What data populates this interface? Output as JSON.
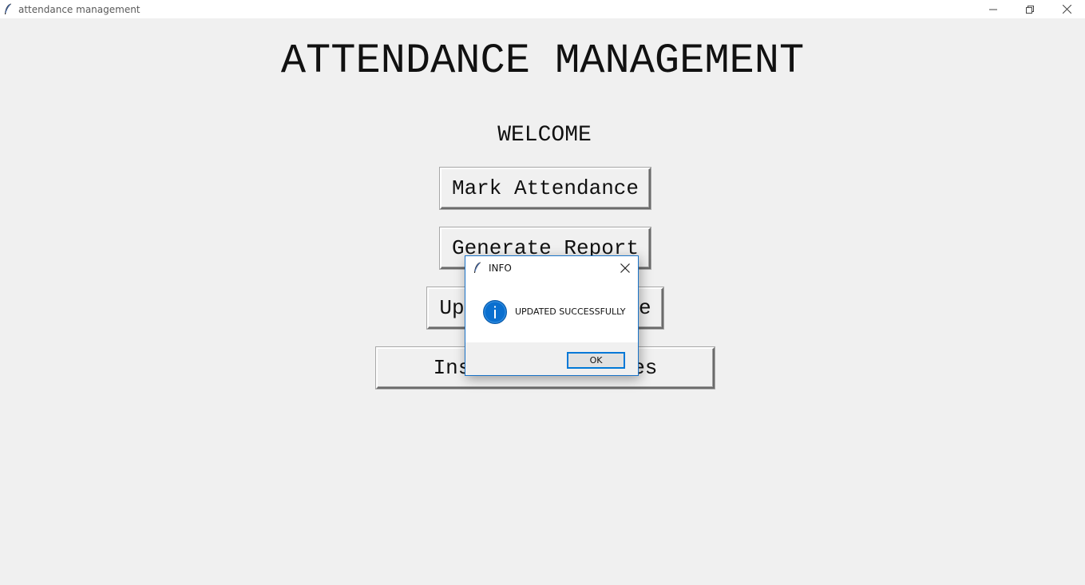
{
  "window": {
    "title": "attendance management"
  },
  "main": {
    "heading": "ATTENDANCE MANAGEMENT",
    "welcome": "WELCOME",
    "buttons": {
      "mark_attendance": "Mark Attendance",
      "generate_report": "Generate Report",
      "update_attendance": "Update Attendance",
      "insert_tables": "Insert Into Tables"
    }
  },
  "dialog": {
    "title": "INFO",
    "message": "UPDATED SUCCESSFULLY",
    "ok_label": "OK",
    "icon": "info-icon"
  },
  "colors": {
    "background": "#f0f0f0",
    "dialog_border": "#1a73c8",
    "info_icon": "#0a6fcf",
    "ok_border": "#0078d7"
  }
}
